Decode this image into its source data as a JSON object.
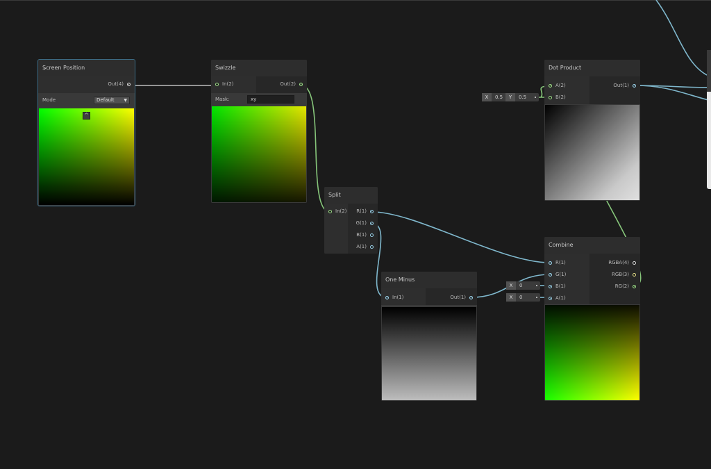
{
  "graph": {
    "colors": {
      "canvas": "#1b1b1b",
      "vector_wire": "#7fb7cc",
      "float_wire": "#86c57a",
      "vector4_wire": "#c8c8c8"
    }
  },
  "nodes": {
    "screen_position": {
      "title": "Screen Position",
      "out": "Out(4)",
      "mode_label": "Mode",
      "mode_value": "Default",
      "toggle_glyph": "^"
    },
    "swizzle": {
      "title": "Swizzle",
      "in": "In(2)",
      "out": "Out(2)",
      "mask_label": "Mask:",
      "mask_value": "xy"
    },
    "split": {
      "title": "Split",
      "in": "In(2)",
      "outs": [
        "R(1)",
        "G(1)",
        "B(1)",
        "A(1)"
      ]
    },
    "one_minus": {
      "title": "One Minus",
      "in": "In(1)",
      "out": "Out(1)"
    },
    "dot_product": {
      "title": "Dot Product",
      "ins": [
        "A(2)",
        "B(2)"
      ],
      "out": "Out(1)",
      "b_default": {
        "x_label": "X",
        "x_value": "0.5",
        "y_label": "Y",
        "y_value": "0.5"
      }
    },
    "combine": {
      "title": "Combine",
      "ins": [
        "R(1)",
        "G(1)",
        "B(1)",
        "A(1)"
      ],
      "outs": [
        "RGBA(4)",
        "RGB(3)",
        "RG(2)"
      ],
      "b_default": {
        "x_label": "X",
        "x_value": "0"
      },
      "a_default": {
        "x_label": "X",
        "x_value": "0"
      }
    }
  }
}
